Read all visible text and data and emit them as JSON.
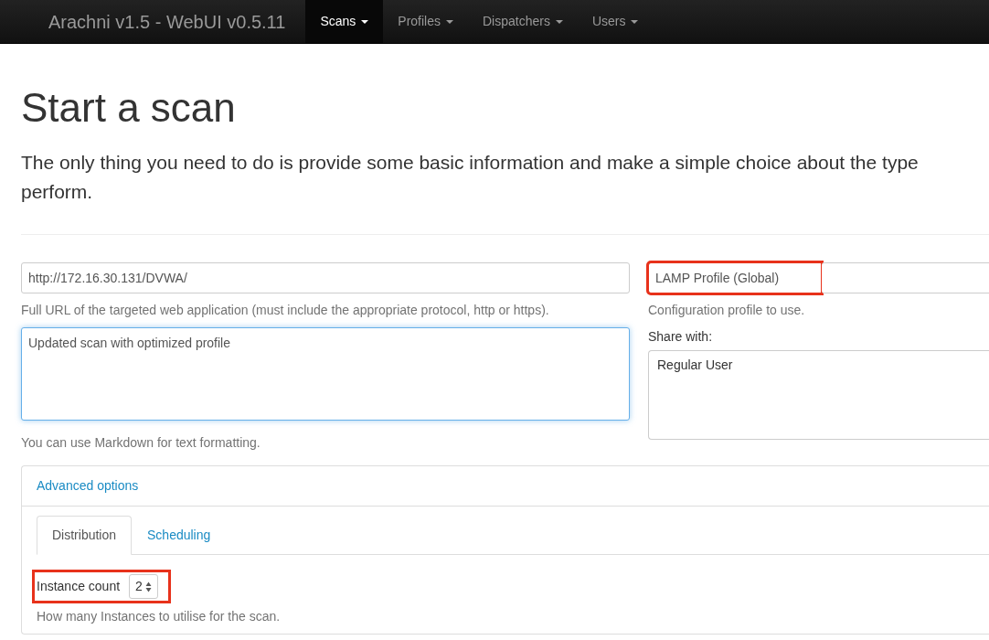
{
  "navbar": {
    "brand": "Arachni v1.5 - WebUI v0.5.11",
    "menus": [
      {
        "label": "Scans",
        "selected": true
      },
      {
        "label": "Profiles",
        "selected": false
      },
      {
        "label": "Dispatchers",
        "selected": false
      },
      {
        "label": "Users",
        "selected": false
      }
    ]
  },
  "page": {
    "title": "Start a scan",
    "lead_lines": [
      "The only thing you need to do is provide some basic information and make a simple choice about the type",
      "perform."
    ]
  },
  "url": {
    "value": "http://172.16.30.131/DVWA/",
    "help": "Full URL of the targeted web application (must include the appropriate protocol, http or https).",
    "highlighted": false
  },
  "description": {
    "value": "Updated scan with optimized profile",
    "help": "You can use Markdown for text formatting."
  },
  "profile": {
    "value": "LAMP Profile (Global)",
    "help": "Configuration profile to use.",
    "highlighted": true
  },
  "share": {
    "label": "Share with:",
    "options": [
      "Regular User"
    ]
  },
  "advanced": {
    "title": "Advanced options",
    "tabs": [
      {
        "label": "Distribution",
        "selected": true
      },
      {
        "label": "Scheduling",
        "selected": false
      }
    ],
    "instance_count": {
      "label": "Instance count",
      "value": "2",
      "help": "How many Instances to utilise for the scan.",
      "highlighted": true
    }
  }
}
